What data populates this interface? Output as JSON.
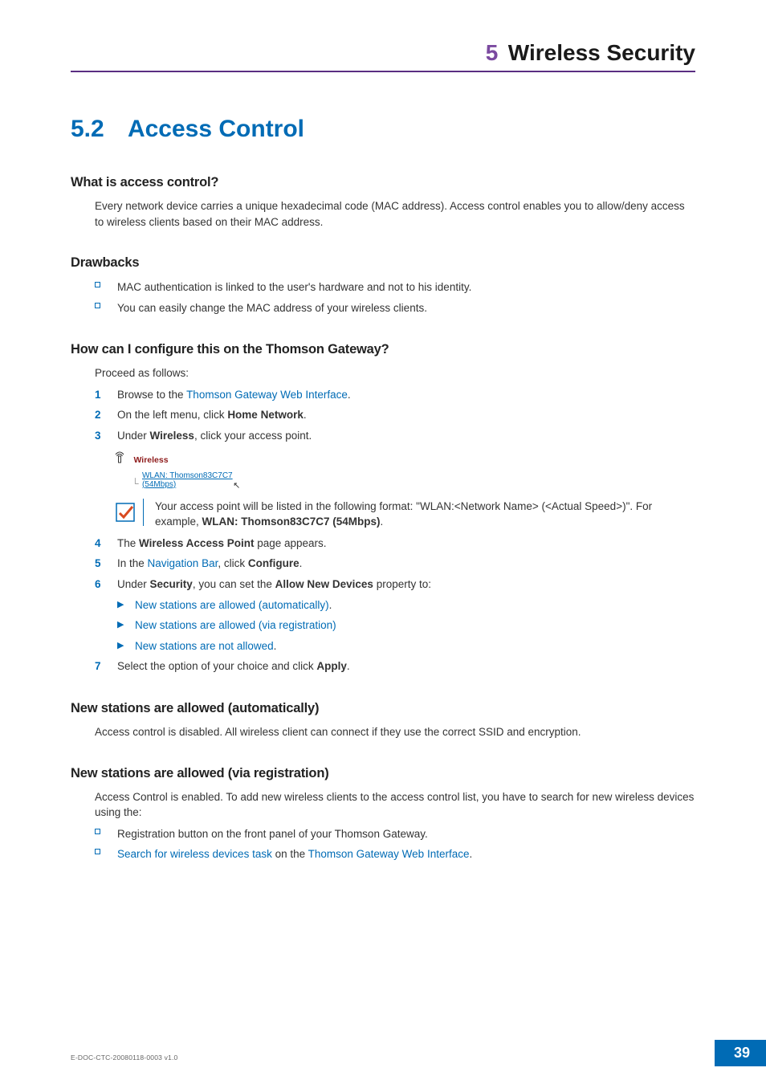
{
  "chapter": {
    "number": "5",
    "title": "Wireless Security"
  },
  "section": {
    "number": "5.2",
    "title": "Access Control"
  },
  "sub_access": {
    "heading": "What is access control?",
    "text": "Every network device carries a unique hexadecimal code (MAC address). Access control enables you to allow/deny access to wireless clients based on their MAC address."
  },
  "sub_drawbacks": {
    "heading": "Drawbacks",
    "items": [
      "MAC authentication is linked to the user's hardware and not to his identity.",
      "You can easily change the MAC address of your wireless clients."
    ]
  },
  "sub_configure": {
    "heading": "How can I configure this on the Thomson Gateway?",
    "intro": "Proceed as follows:",
    "step1_pre": "Browse to the ",
    "step1_link": "Thomson Gateway Web Interface",
    "step1_post": ".",
    "step2_pre": "On the left menu, click ",
    "step2_bold": "Home Network",
    "step2_post": ".",
    "step3_pre": "Under ",
    "step3_bold": "Wireless",
    "step3_post": ", click your access point.",
    "wifi_label": "Wireless",
    "wlan_line1": "WLAN: Thomson83C7C7",
    "wlan_line2": "(54Mbps)",
    "note_pre": "Your access point will be listed in the following format: \"WLAN:<Network Name> (<Actual Speed>)\". For example, ",
    "note_bold": "WLAN: Thomson83C7C7 (54Mbps)",
    "note_post": ".",
    "step4_pre": "The ",
    "step4_bold": "Wireless Access Point",
    "step4_post": " page appears.",
    "step5_pre": "In the ",
    "step5_link": "Navigation Bar",
    "step5_mid": ", click ",
    "step5_bold": "Configure",
    "step5_post": ".",
    "step6_pre": "Under ",
    "step6_bold1": "Security",
    "step6_mid": ", you can set the ",
    "step6_bold2": "Allow New Devices",
    "step6_post": " property to:",
    "sub_items": [
      {
        "link": "New stations are allowed (automatically)",
        "post": "."
      },
      {
        "link": "New stations are allowed (via registration)",
        "post": ""
      },
      {
        "link": "New stations are not allowed",
        "post": "."
      }
    ],
    "step7_pre": "Select the option of your choice and click ",
    "step7_bold": "Apply",
    "step7_post": "."
  },
  "sub_auto": {
    "heading": "New stations are allowed (automatically)",
    "text": "Access control is disabled. All wireless client can connect if they use the correct SSID and encryption."
  },
  "sub_reg": {
    "heading": "New stations are allowed (via registration)",
    "text": "Access Control is enabled. To add new wireless clients to the access control list, you have to search for new wireless devices using the:",
    "b1": "Registration button on the front panel of your Thomson Gateway.",
    "b2_link1": "Search for wireless devices task",
    "b2_mid": " on the ",
    "b2_link2": "Thomson Gateway Web Interface",
    "b2_post": "."
  },
  "footer": {
    "doc": "E-DOC-CTC-20080118-0003 v1.0",
    "page": "39"
  }
}
